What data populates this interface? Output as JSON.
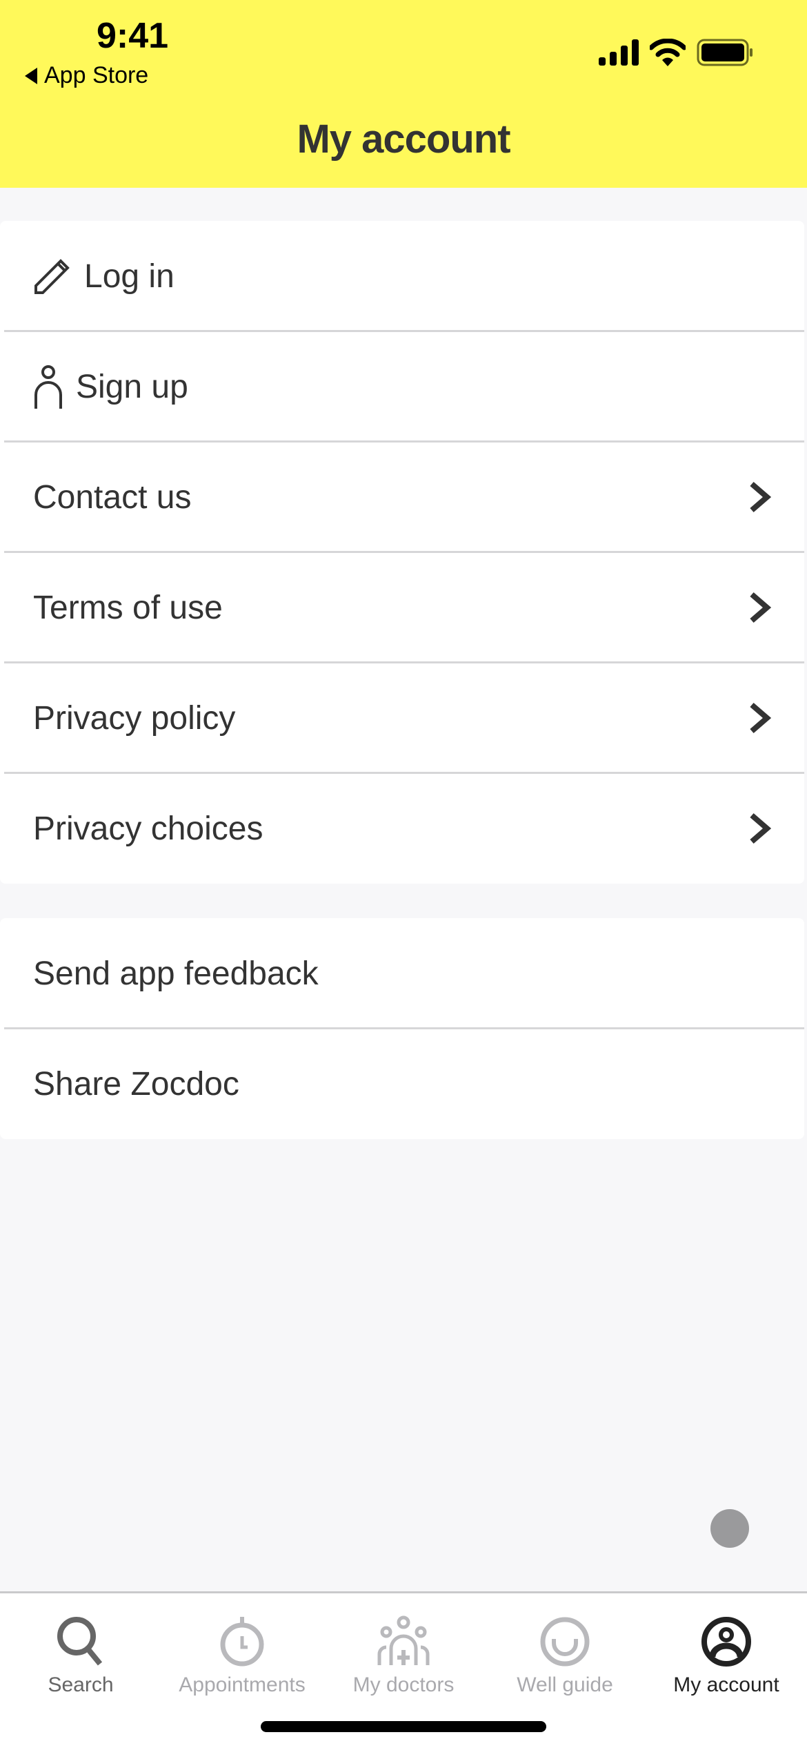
{
  "status_bar": {
    "time": "9:41",
    "back_label": "App Store",
    "icons": [
      "cellular-signal-icon",
      "wifi-icon",
      "battery-icon"
    ]
  },
  "header": {
    "title": "My account",
    "background_color": "#fff95a"
  },
  "menu_group_1": [
    {
      "label": "Log in",
      "icon": "pencil-icon",
      "chevron": false
    },
    {
      "label": "Sign up",
      "icon": "person-icon",
      "chevron": false
    },
    {
      "label": "Contact us",
      "icon": null,
      "chevron": true
    },
    {
      "label": "Terms of use",
      "icon": null,
      "chevron": true
    },
    {
      "label": "Privacy policy",
      "icon": null,
      "chevron": true
    },
    {
      "label": "Privacy choices",
      "icon": null,
      "chevron": true
    }
  ],
  "menu_group_2": [
    {
      "label": "Send app feedback"
    },
    {
      "label": "Share Zocdoc"
    }
  ],
  "tab_bar": {
    "tabs": [
      {
        "label": "Search",
        "icon": "search-icon",
        "state": "default"
      },
      {
        "label": "Appointments",
        "icon": "stopwatch-icon",
        "state": "inactive"
      },
      {
        "label": "My doctors",
        "icon": "doctors-group-icon",
        "state": "inactive"
      },
      {
        "label": "Well guide",
        "icon": "smile-icon",
        "state": "inactive"
      },
      {
        "label": "My account",
        "icon": "account-circle-icon",
        "state": "active"
      }
    ]
  }
}
